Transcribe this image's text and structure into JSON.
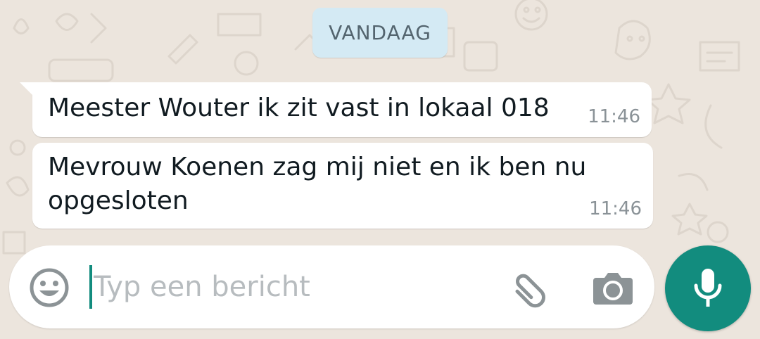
{
  "chat": {
    "date_chip": "VANDAAG",
    "messages": [
      {
        "lines": [
          "Meester Wouter ik zit vast in lokaal 018"
        ],
        "time": "11:46"
      },
      {
        "lines": [
          "Mevrouw Koenen zag mij niet en ik ben nu",
          "opgesloten"
        ],
        "time": "11:46"
      }
    ]
  },
  "composer": {
    "placeholder": "Typ een bericht",
    "value": "",
    "icons": {
      "emoji": "emoji-icon",
      "attach": "paperclip-icon",
      "camera": "camera-icon",
      "mic": "microphone-icon"
    }
  },
  "colors": {
    "wallpaper": "#ECE5DD",
    "bubble": "#FFFFFF",
    "date_chip": "#D4EAF4",
    "accent": "#128C7E",
    "timestamp": "#8A9297",
    "icon_gray": "#8C9396"
  }
}
